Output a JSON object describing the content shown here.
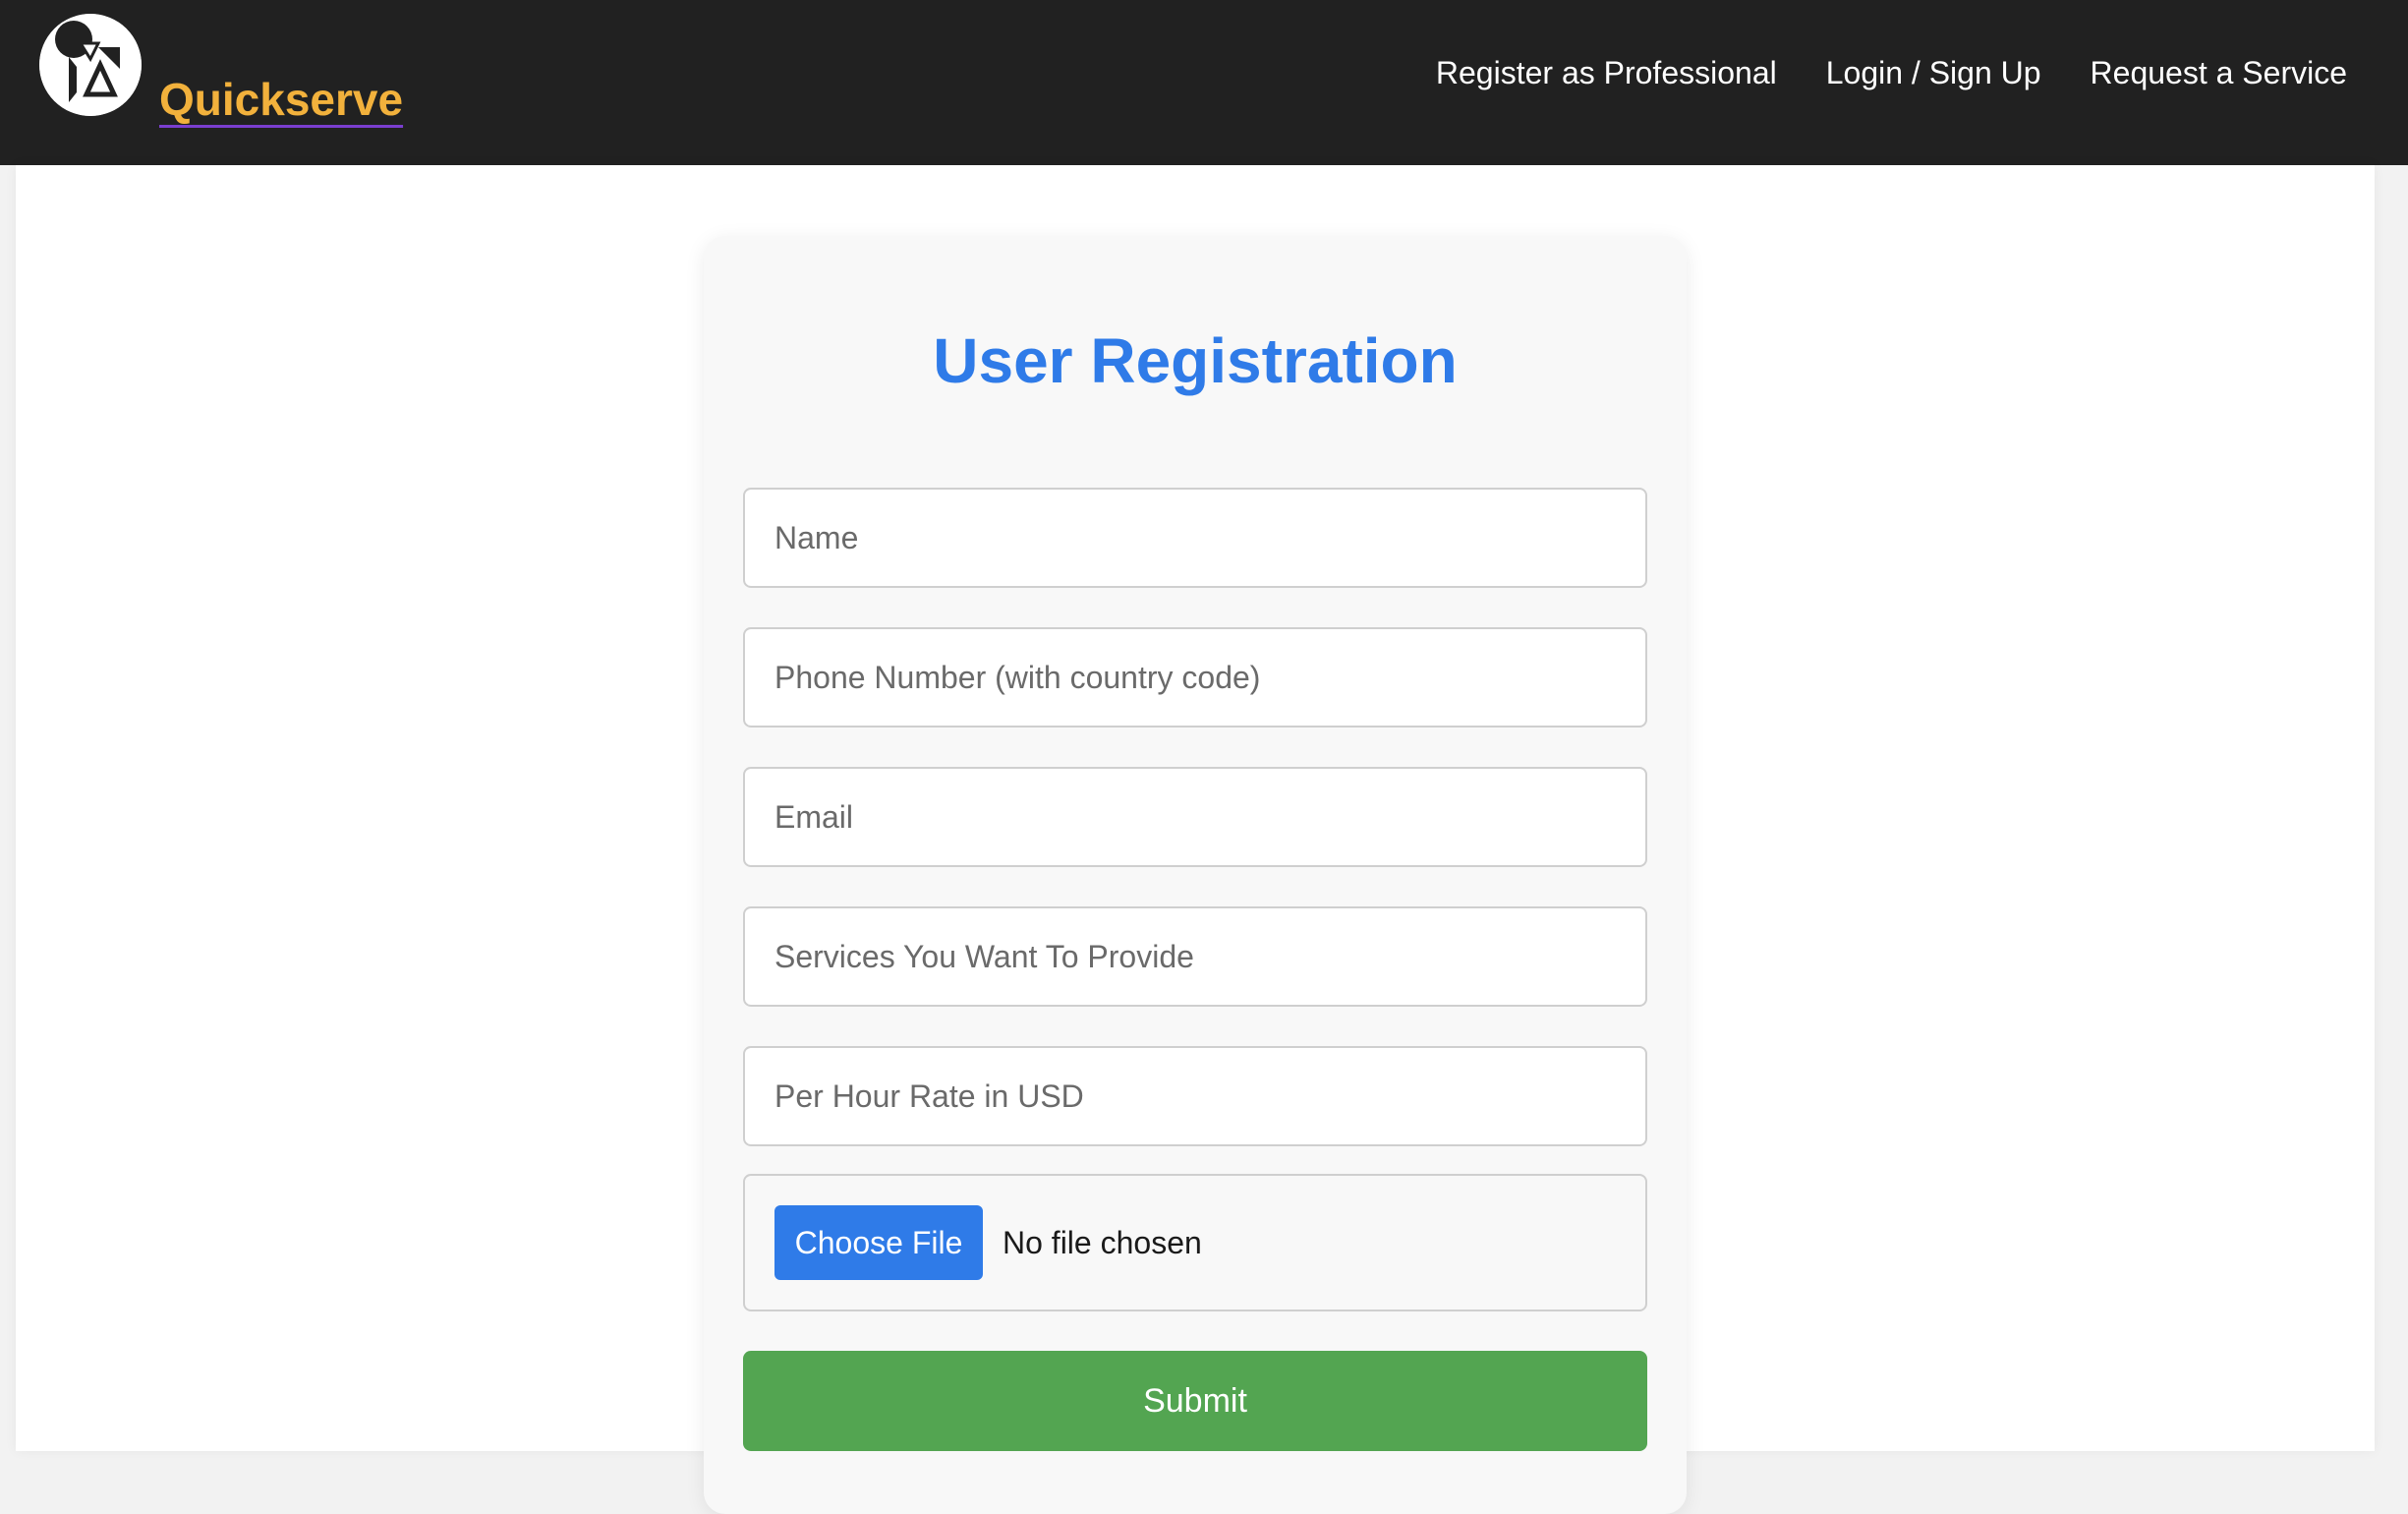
{
  "header": {
    "brand_name": "Quickserve",
    "logo_icon": "quickserve-logo-icon",
    "nav_links": [
      "Register as Professional",
      "Login / Sign Up",
      "Request a Service"
    ]
  },
  "form": {
    "title": "User Registration",
    "fields": {
      "name": {
        "placeholder": "Name",
        "value": ""
      },
      "phone": {
        "placeholder": "Phone Number (with country code)",
        "value": ""
      },
      "email": {
        "placeholder": "Email",
        "value": ""
      },
      "services": {
        "placeholder": "Services You Want To Provide",
        "value": ""
      },
      "rate": {
        "placeholder": "Per Hour Rate in USD",
        "value": ""
      }
    },
    "file_upload": {
      "button_label": "Choose File",
      "status": "No file chosen"
    },
    "submit_label": "Submit"
  },
  "colors": {
    "navbar_bg": "#212121",
    "brand": "#f2b13c",
    "title": "#2f7be8",
    "file_button": "#2f7be8",
    "submit": "#53a551"
  }
}
